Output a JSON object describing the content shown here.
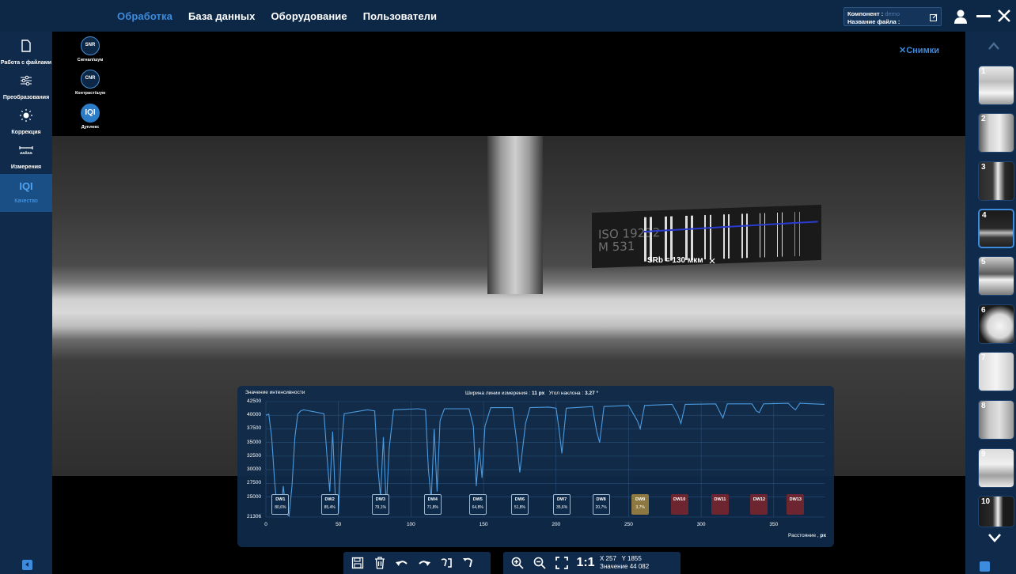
{
  "topbar": {
    "menu": [
      "Обработка",
      "База данных",
      "Оборудование",
      "Пользователи"
    ],
    "component_label": "Компонент :",
    "component_value": "demo",
    "file_label": "Название файла :",
    "file_value": ""
  },
  "sidebar": {
    "items": [
      {
        "label": "Работа с файлами",
        "icon": "file-icon"
      },
      {
        "label": "Преобразования",
        "icon": "sliders-icon"
      },
      {
        "label": "Коррекция",
        "icon": "brightness-icon"
      },
      {
        "label": "Измерения",
        "icon": "ruler-icon"
      },
      {
        "label": "Качество",
        "icon": "iqi-icon",
        "text": "IQI"
      }
    ]
  },
  "tools": [
    {
      "abbr": "SNR",
      "label": "Сигнал/шум"
    },
    {
      "abbr": "CNR",
      "label": "Контраст/шум"
    },
    {
      "abbr": "IQI",
      "label": "Дуплекс"
    }
  ],
  "viewer": {
    "snapshots_label": "Снимки",
    "plate_line1": "ISO 19232",
    "plate_line2": "M 531",
    "measure_label": "SRb = 130 мкм"
  },
  "chart_data": {
    "type": "line",
    "ylabel": "Значение интенсивности",
    "xlabel": "Расстояние ,",
    "xlabel_unit": "px",
    "info_width_label": "Ширина линии измерения :",
    "info_width_value": "11",
    "info_width_unit": "px",
    "info_angle_label": "Угол наклона :",
    "info_angle_value": "3.27 °",
    "ylim": [
      21306,
      42500
    ],
    "yticks": [
      "42500",
      "40000",
      "37500",
      "35000",
      "32500",
      "30000",
      "27500",
      "25000",
      "21306"
    ],
    "xlim": [
      0,
      385
    ],
    "xticks": [
      "0",
      "50",
      "100",
      "150",
      "200",
      "250",
      "300",
      "350"
    ],
    "x": [
      0,
      2,
      4,
      6,
      8,
      10,
      12,
      14,
      16,
      18,
      20,
      22,
      24,
      26,
      28,
      30,
      40,
      42,
      44,
      46,
      48,
      50,
      52,
      54,
      70,
      75,
      77,
      79,
      81,
      83,
      85,
      88,
      105,
      110,
      112,
      114,
      116,
      118,
      120,
      123,
      140,
      143,
      145,
      147,
      149,
      151,
      155,
      170,
      173,
      175,
      177,
      179,
      182,
      195,
      200,
      202,
      204,
      207,
      225,
      228,
      230,
      233,
      250,
      256,
      258,
      261,
      280,
      284,
      286,
      289,
      310,
      313,
      315,
      318,
      335,
      338,
      340,
      343,
      360,
      363,
      365,
      368,
      385
    ],
    "values": [
      40000,
      40200,
      36000,
      28000,
      22000,
      21800,
      27000,
      22000,
      21500,
      27000,
      36000,
      40200,
      40800,
      41000,
      40900,
      40800,
      40300,
      33000,
      26000,
      37000,
      24000,
      22000,
      34000,
      40300,
      41000,
      40800,
      31000,
      25000,
      36000,
      23000,
      34000,
      41000,
      41200,
      41000,
      30000,
      24500,
      37500,
      26000,
      39000,
      41200,
      41200,
      38000,
      27000,
      34000,
      28500,
      38000,
      41400,
      41400,
      35000,
      29500,
      34000,
      38500,
      41400,
      41500,
      41300,
      37500,
      33000,
      41300,
      41600,
      37000,
      35000,
      41600,
      41800,
      39000,
      37500,
      41800,
      42000,
      40000,
      38500,
      42000,
      42100,
      40500,
      39500,
      42100,
      42100,
      40800,
      40500,
      42100,
      42200,
      41400,
      41000,
      42200,
      42000
    ],
    "wires": [
      {
        "name": "DW1",
        "value": "80,6%",
        "status": "pass",
        "x": 10
      },
      {
        "name": "DW2",
        "value": "85,4%",
        "status": "pass",
        "x": 44
      },
      {
        "name": "DW3",
        "value": "79,1%",
        "status": "pass",
        "x": 79
      },
      {
        "name": "DW4",
        "value": "71,8%",
        "status": "pass",
        "x": 115
      },
      {
        "name": "DW5",
        "value": "64,8%",
        "status": "pass",
        "x": 146
      },
      {
        "name": "DW6",
        "value": "51,8%",
        "status": "pass",
        "x": 175
      },
      {
        "name": "DW7",
        "value": "35,6%",
        "status": "pass",
        "x": 204
      },
      {
        "name": "DW8",
        "value": "20,7%",
        "status": "pass",
        "x": 231
      },
      {
        "name": "DW9",
        "value": "3,7%",
        "status": "warn",
        "x": 258
      },
      {
        "name": "DW10",
        "value": "",
        "status": "fail",
        "x": 285
      },
      {
        "name": "DW11",
        "value": "",
        "status": "fail",
        "x": 313
      },
      {
        "name": "DW12",
        "value": "",
        "status": "fail",
        "x": 340
      },
      {
        "name": "DW13",
        "value": "",
        "status": "fail",
        "x": 365
      }
    ]
  },
  "thumbnails": [
    "1",
    "2",
    "3",
    "4",
    "5",
    "6",
    "7",
    "8",
    "9",
    "10"
  ],
  "active_thumbnail": "4",
  "status": {
    "x": "X 257",
    "y": "Y 1855",
    "value": "Значение 44 082",
    "zoom": "1:1"
  },
  "colors": {
    "accent": "#3d8bdd",
    "panel": "#0f2a4b",
    "topbar": "#0d2846",
    "curve": "#4b9be0",
    "fail": "#6d2530",
    "warn": "#8c7840"
  }
}
